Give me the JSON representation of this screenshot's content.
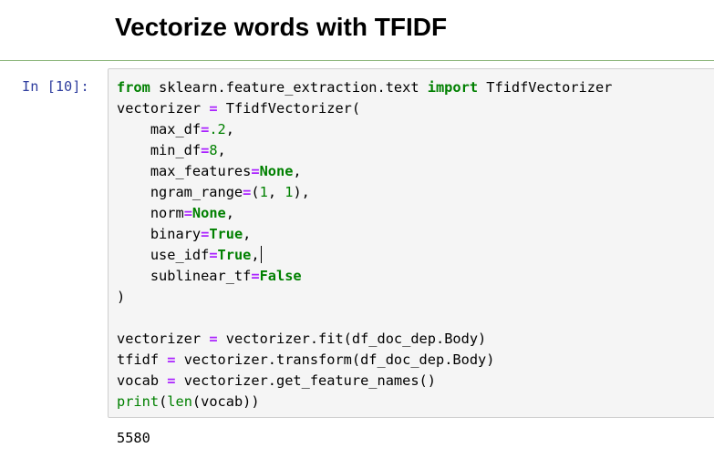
{
  "markdown_cell": {
    "title": "Vectorize words with TFIDF"
  },
  "code_cell": {
    "prompt": "In [10]:",
    "lines": [
      [
        {
          "t": "from",
          "c": "kw"
        },
        {
          "t": " sklearn.feature_extraction.text ",
          "c": ""
        },
        {
          "t": "import",
          "c": "kw"
        },
        {
          "t": " TfidfVectorizer",
          "c": ""
        }
      ],
      [
        {
          "t": "vectorizer ",
          "c": ""
        },
        {
          "t": "=",
          "c": "op"
        },
        {
          "t": " TfidfVectorizer(",
          "c": ""
        }
      ],
      [
        {
          "t": "    max_df",
          "c": ""
        },
        {
          "t": "=",
          "c": "op"
        },
        {
          "t": ".2",
          "c": "num"
        },
        {
          "t": ",",
          "c": ""
        }
      ],
      [
        {
          "t": "    min_df",
          "c": ""
        },
        {
          "t": "=",
          "c": "op"
        },
        {
          "t": "8",
          "c": "num"
        },
        {
          "t": ",",
          "c": ""
        }
      ],
      [
        {
          "t": "    max_features",
          "c": ""
        },
        {
          "t": "=",
          "c": "op"
        },
        {
          "t": "None",
          "c": "kw"
        },
        {
          "t": ",",
          "c": ""
        }
      ],
      [
        {
          "t": "    ngram_range",
          "c": ""
        },
        {
          "t": "=",
          "c": "op"
        },
        {
          "t": "(",
          "c": ""
        },
        {
          "t": "1",
          "c": "num"
        },
        {
          "t": ", ",
          "c": ""
        },
        {
          "t": "1",
          "c": "num"
        },
        {
          "t": "),",
          "c": ""
        }
      ],
      [
        {
          "t": "    norm",
          "c": ""
        },
        {
          "t": "=",
          "c": "op"
        },
        {
          "t": "None",
          "c": "kw"
        },
        {
          "t": ",",
          "c": ""
        }
      ],
      [
        {
          "t": "    binary",
          "c": ""
        },
        {
          "t": "=",
          "c": "op"
        },
        {
          "t": "True",
          "c": "kw"
        },
        {
          "t": ",",
          "c": ""
        }
      ],
      [
        {
          "t": "    use_idf",
          "c": ""
        },
        {
          "t": "=",
          "c": "op"
        },
        {
          "t": "True",
          "c": "kw"
        },
        {
          "t": ",",
          "c": ""
        },
        {
          "t": "",
          "c": "cursor"
        }
      ],
      [
        {
          "t": "    sublinear_tf",
          "c": ""
        },
        {
          "t": "=",
          "c": "op"
        },
        {
          "t": "False",
          "c": "kw"
        }
      ],
      [
        {
          "t": ")",
          "c": ""
        }
      ],
      [
        {
          "t": "",
          "c": ""
        }
      ],
      [
        {
          "t": "vectorizer ",
          "c": ""
        },
        {
          "t": "=",
          "c": "op"
        },
        {
          "t": " vectorizer.fit(df_doc_dep.Body)",
          "c": ""
        }
      ],
      [
        {
          "t": "tfidf ",
          "c": ""
        },
        {
          "t": "=",
          "c": "op"
        },
        {
          "t": " vectorizer.transform(df_doc_dep.Body)",
          "c": ""
        }
      ],
      [
        {
          "t": "vocab ",
          "c": ""
        },
        {
          "t": "=",
          "c": "op"
        },
        {
          "t": " vectorizer.get_feature_names()",
          "c": ""
        }
      ],
      [
        {
          "t": "print",
          "c": "bi"
        },
        {
          "t": "(",
          "c": ""
        },
        {
          "t": "len",
          "c": "bi"
        },
        {
          "t": "(vocab))",
          "c": ""
        }
      ]
    ]
  },
  "output_cell": {
    "text": "5580"
  },
  "colors": {
    "keyword": "#008000",
    "operator": "#aa22ff",
    "prompt": "#303f9f",
    "cell_border": "#cfcfcf",
    "cell_background": "#f5f5f5",
    "markdown_divider": "#8ab57a"
  }
}
